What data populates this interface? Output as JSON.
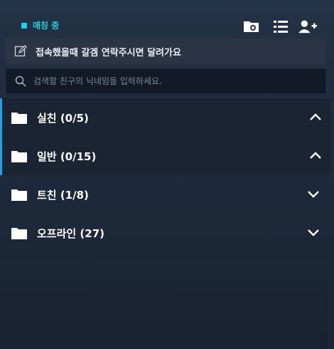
{
  "status": {
    "label": "매칭 중",
    "color": "#1fd0e0"
  },
  "toolbar": {
    "icons": [
      "folder-settings-icon",
      "list-icon",
      "add-friend-icon"
    ]
  },
  "memo": {
    "text": "접속했을때 갈겜 연락주시면 달려가요"
  },
  "search": {
    "placeholder": "검색할 친구의 닉네임을 입력하세요."
  },
  "groups": [
    {
      "label": "실친 (0/5)",
      "expanded": true
    },
    {
      "label": "일반 (0/15)",
      "expanded": true
    },
    {
      "label": "트친 (1/8)",
      "expanded": false
    },
    {
      "label": "오프라인 (27)",
      "expanded": false
    }
  ],
  "colors": {
    "accent": "#1aa4e6",
    "cyan": "#1fd0e0",
    "bg": "#1f2a3a"
  }
}
